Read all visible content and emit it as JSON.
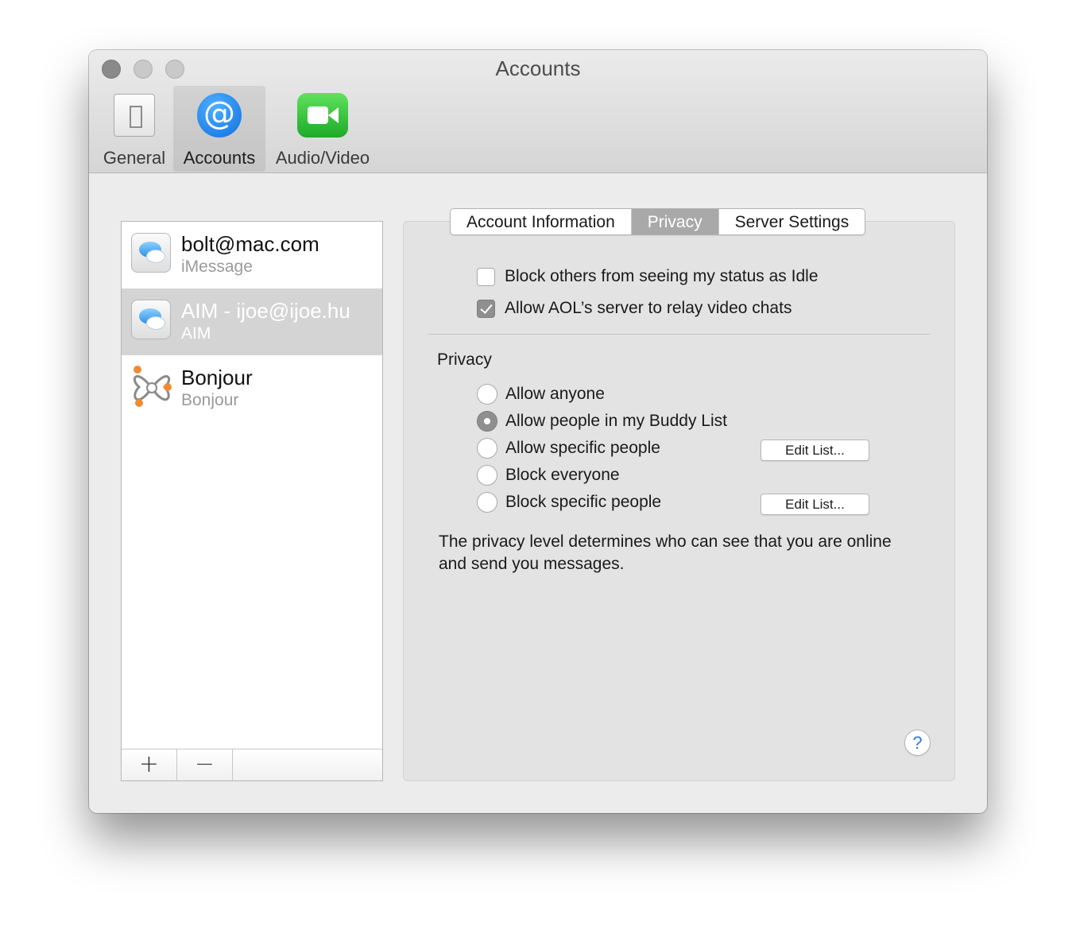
{
  "window": {
    "title": "Accounts"
  },
  "toolbar": {
    "items": [
      {
        "label": "General",
        "icon": "general-switch-icon",
        "selected": false
      },
      {
        "label": "Accounts",
        "icon": "at-sign-icon",
        "selected": true
      },
      {
        "label": "Audio/Video",
        "icon": "video-camera-icon",
        "selected": false
      }
    ]
  },
  "accounts": [
    {
      "name": "bolt@mac.com",
      "service": "iMessage",
      "icon": "messages-icon",
      "selected": false
    },
    {
      "name": "AIM - ijoe@ijoe.hu",
      "service": "AIM",
      "icon": "messages-icon",
      "selected": true
    },
    {
      "name": "Bonjour",
      "service": "Bonjour",
      "icon": "bonjour-icon",
      "selected": false
    }
  ],
  "list_footer": {
    "add_label": "+",
    "remove_label": "−"
  },
  "tabs": [
    {
      "label": "Account Information",
      "active": false
    },
    {
      "label": "Privacy",
      "active": true
    },
    {
      "label": "Server Settings",
      "active": false
    }
  ],
  "options": {
    "block_idle": {
      "label": "Block others from seeing my status as Idle",
      "checked": false
    },
    "relay_video": {
      "label": "Allow AOL’s server to relay video chats",
      "checked": true
    }
  },
  "privacy": {
    "title": "Privacy",
    "choices": [
      {
        "label": "Allow anyone",
        "selected": false
      },
      {
        "label": "Allow people in my Buddy List",
        "selected": true
      },
      {
        "label": "Allow specific people",
        "selected": false
      },
      {
        "label": "Block everyone",
        "selected": false
      },
      {
        "label": "Block specific people",
        "selected": false
      }
    ],
    "edit_list_label": "Edit List...",
    "description": "The privacy level determines who can see that you are online and send you messages."
  },
  "help": {
    "label": "?"
  },
  "colors": {
    "accent_blue": "#2e7ae0",
    "selected_row": "#d4d4d4",
    "selected_tab": "#a9a9a9",
    "facetime_green": "#2fc23a"
  }
}
